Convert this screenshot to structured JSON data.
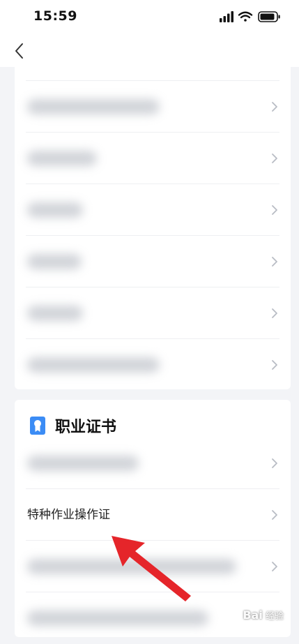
{
  "status_bar": {
    "time": "15:59",
    "icons": [
      "signal-icon",
      "wifi-icon",
      "battery-icon"
    ]
  },
  "nav": {
    "back_icon": "chevron-left-icon"
  },
  "card1": {
    "rows": [
      {
        "blurred": true
      },
      {
        "blurred": true
      },
      {
        "blurred": true
      },
      {
        "blurred": true
      },
      {
        "blurred": true
      },
      {
        "blurred": true
      }
    ]
  },
  "card2": {
    "title": "职业证书",
    "title_icon": "certificate-icon",
    "rows": [
      {
        "blurred": true,
        "label": ""
      },
      {
        "blurred": false,
        "label": "特种作业操作证"
      },
      {
        "blurred": true,
        "label": ""
      },
      {
        "blurred": true,
        "label": ""
      }
    ]
  },
  "annotation": {
    "arrow_color": "#e5252a"
  },
  "watermark": {
    "logo": "Bai",
    "text": "经验"
  },
  "colors": {
    "accent": "#3b8cf5",
    "page_bg": "#f3f4f7",
    "card_bg": "#ffffff",
    "chevron": "#b8bcc4"
  }
}
